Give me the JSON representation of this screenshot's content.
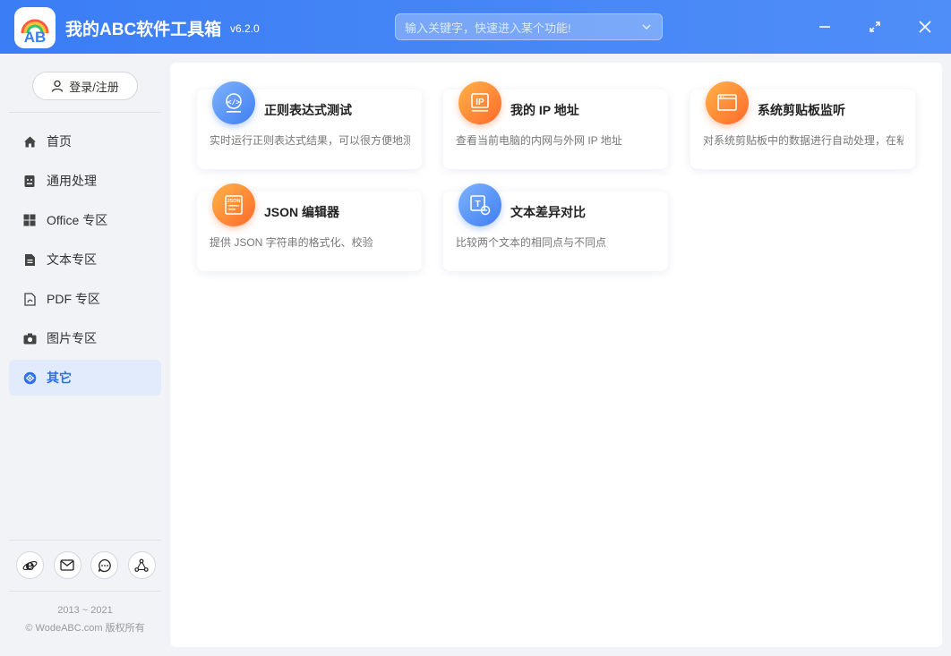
{
  "app": {
    "title": "我的ABC软件工具箱",
    "version": "v6.2.0",
    "logo_text": "AB"
  },
  "search": {
    "placeholder": "输入关键字，快速进入某个功能!",
    "value": ""
  },
  "window_controls": [
    "minimize-icon",
    "maximize-icon",
    "close-icon"
  ],
  "sidebar": {
    "login_label": "登录/注册",
    "items": [
      {
        "label": "首页",
        "icon": "home-icon",
        "active": false
      },
      {
        "label": "通用处理",
        "icon": "general-icon",
        "active": false
      },
      {
        "label": "Office 专区",
        "icon": "windows-icon",
        "active": false
      },
      {
        "label": "文本专区",
        "icon": "text-file-icon",
        "active": false
      },
      {
        "label": "PDF 专区",
        "icon": "pdf-file-icon",
        "active": false
      },
      {
        "label": "图片专区",
        "icon": "camera-icon",
        "active": false
      },
      {
        "label": "其它",
        "icon": "other-icon",
        "active": true
      }
    ],
    "footer_icons": [
      "ie-icon",
      "mail-icon",
      "chat-icon",
      "share-icon"
    ],
    "copyright_years": "2013 ~ 2021",
    "copyright_text": "© WodeABC.com 版权所有"
  },
  "cards": [
    {
      "title": "正则表达式测试",
      "desc": "实时运行正则表达式结果，可以很方便地测试",
      "icon": "code-icon",
      "color": "#3f7ef0"
    },
    {
      "title": "我的 IP 地址",
      "desc": "查看当前电脑的内网与外网 IP 地址",
      "icon": "ip-icon",
      "color": "#ff6a2b"
    },
    {
      "title": "系统剪贴板监听",
      "desc": "对系统剪贴板中的数据进行自动处理，在粘贴",
      "icon": "clipboard-window-icon",
      "color": "#ff6a2b"
    },
    {
      "title": "JSON 编辑器",
      "desc": "提供 JSON 字符串的格式化、校验",
      "icon": "json-icon",
      "color": "#ff6a2b"
    },
    {
      "title": "文本差异对比",
      "desc": "比较两个文本的相同点与不同点",
      "icon": "text-compare-icon",
      "color": "#3f7ef0"
    }
  ],
  "colors": {
    "titlebar": "#3b7df5",
    "accent": "#2f6fe8",
    "active_bg": "#e1ebfc"
  }
}
